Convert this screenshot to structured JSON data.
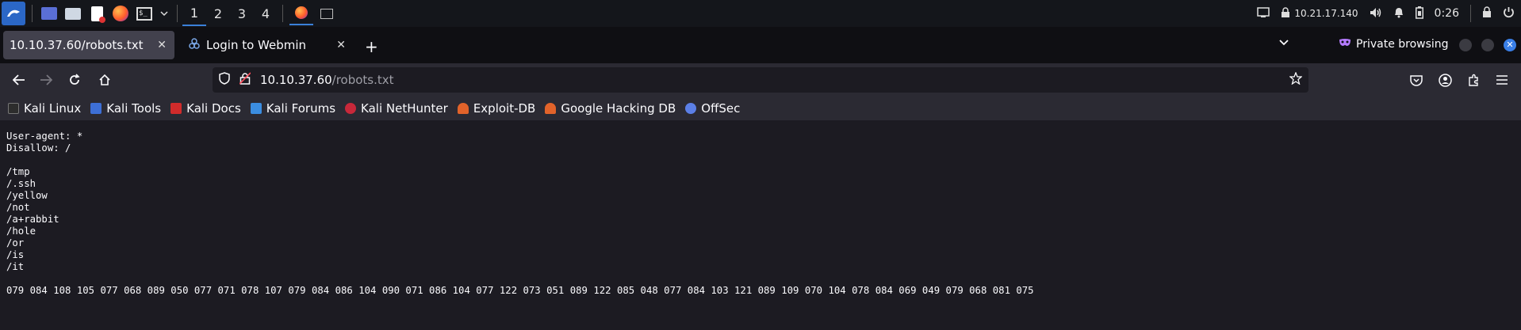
{
  "taskbar": {
    "workspaces": [
      "1",
      "2",
      "3",
      "4"
    ],
    "ip": "10.21.17.140",
    "clock": "0:26"
  },
  "tabs": [
    {
      "title": "10.10.37.60/robots.txt"
    },
    {
      "title": "Login to Webmin"
    }
  ],
  "private_label": "Private browsing",
  "url": {
    "host": "10.10.37.60",
    "path": "/robots.txt"
  },
  "bookmarks": [
    {
      "label": "Kali Linux",
      "color": "#2d2d2d"
    },
    {
      "label": "Kali Tools",
      "color": "#3d6fd6"
    },
    {
      "label": "Kali Docs",
      "color": "#d12b2b"
    },
    {
      "label": "Kali Forums",
      "color": "#3b8de0"
    },
    {
      "label": "Kali NetHunter",
      "color": "#c8283a"
    },
    {
      "label": "Exploit-DB",
      "color": "#e2632a"
    },
    {
      "label": "Google Hacking DB",
      "color": "#e2632a"
    },
    {
      "label": "OffSec",
      "color": "#5b7fe6"
    }
  ],
  "page_text": "User-agent: *\nDisallow: /\n\n/tmp\n/.ssh\n/yellow\n/not\n/a+rabbit\n/hole\n/or\n/is\n/it\n\n079 084 108 105 077 068 089 050 077 071 078 107 079 084 086 104 090 071 086 104 077 122 073 051 089 122 085 048 077 084 103 121 089 109 070 104 078 084 069 049 079 068 081 075"
}
